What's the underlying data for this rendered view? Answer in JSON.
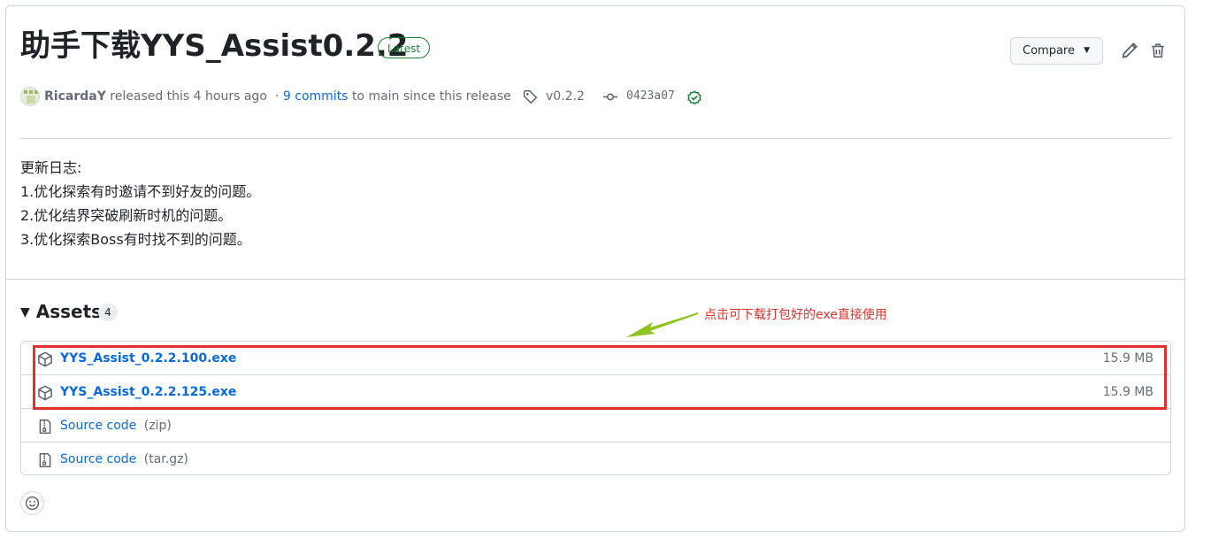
{
  "release": {
    "title": "助手下载YYS_Assist0.2.2",
    "badge": "Latest",
    "compare_label": "Compare",
    "author": "RicardaY",
    "released_text": "released this 4 hours ago",
    "commits_link": "9 commits",
    "commits_suffix": "to main since this release",
    "tag": "v0.2.2",
    "commit": "0423a07",
    "accent": "#1a7f37"
  },
  "notes": {
    "heading": "更新日志:",
    "items": [
      "1.优化探索有时邀请不到好友的问题。",
      "2.优化结界突破刷新时机的问题。",
      "3.优化探索Boss有时找不到的问题。"
    ]
  },
  "assets": {
    "label": "Assets",
    "count": "4",
    "annotation": "点击可下载打包好的exe直接使用",
    "items": [
      {
        "name": "YYS_Assist_0.2.2.100.exe",
        "ext": "",
        "size": "15.9 MB",
        "icon": "package-icon"
      },
      {
        "name": "YYS_Assist_0.2.2.125.exe",
        "ext": "",
        "size": "15.9 MB",
        "icon": "package-icon"
      },
      {
        "name": "Source code",
        "ext": "(zip)",
        "size": "",
        "icon": "file-zip-icon"
      },
      {
        "name": "Source code",
        "ext": "(tar.gz)",
        "size": "",
        "icon": "file-zip-icon"
      }
    ]
  },
  "colors": {
    "link": "#0969da",
    "annotation": "#e0302c",
    "arrow": "#8fc31f"
  }
}
